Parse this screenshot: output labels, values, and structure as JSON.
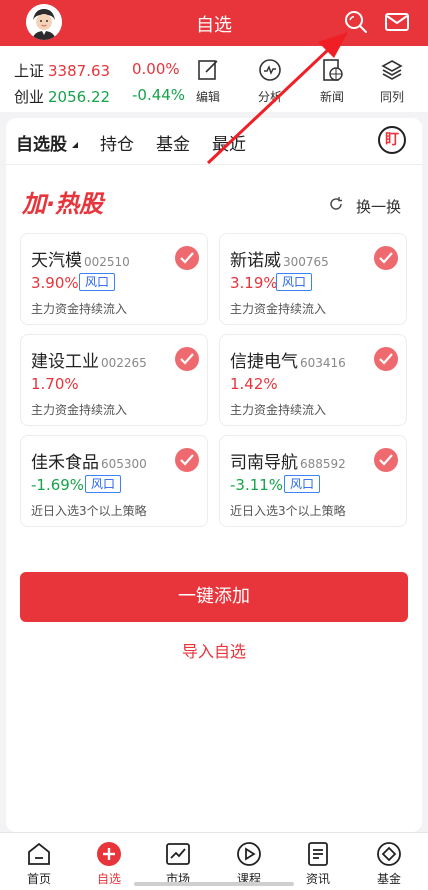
{
  "header": {
    "title": "自选"
  },
  "indices": [
    {
      "name": "上证",
      "value": "3387.63",
      "change": "0.00%",
      "value_color": "red",
      "change_color": "red"
    },
    {
      "name": "创业",
      "value": "2056.22",
      "change": "-0.44%",
      "value_color": "green",
      "change_color": "green"
    }
  ],
  "toolbar": [
    {
      "icon": "edit-icon",
      "label": "编辑"
    },
    {
      "icon": "analysis-icon",
      "label": "分析"
    },
    {
      "icon": "news-icon",
      "label": "新闻"
    },
    {
      "icon": "peer-icon",
      "label": "同列"
    }
  ],
  "tabs": [
    "自选股",
    "持仓",
    "基金",
    "最近"
  ],
  "ding_label": "盯",
  "promo": {
    "title": "加·热股",
    "swap_label": "换一换"
  },
  "stocks": [
    {
      "name": "天汽模",
      "code": "002510",
      "change": "3.90%",
      "color": "red",
      "tag": "风口",
      "desc": "主力资金持续流入"
    },
    {
      "name": "新诺威",
      "code": "300765",
      "change": "3.19%",
      "color": "red",
      "tag": "风口",
      "desc": "主力资金持续流入"
    },
    {
      "name": "建设工业",
      "code": "002265",
      "change": "1.70%",
      "color": "red",
      "tag": "",
      "desc": "主力资金持续流入"
    },
    {
      "name": "信捷电气",
      "code": "603416",
      "change": "1.42%",
      "color": "red",
      "tag": "",
      "desc": "主力资金持续流入"
    },
    {
      "name": "佳禾食品",
      "code": "605300",
      "change": "-1.69%",
      "color": "green",
      "tag": "风口",
      "desc": "近日入选3个以上策略"
    },
    {
      "name": "司南导航",
      "code": "688592",
      "change": "-3.11%",
      "color": "green",
      "tag": "风口",
      "desc": "近日入选3个以上策略"
    }
  ],
  "actions": {
    "add_all": "一键添加",
    "import": "导入自选"
  },
  "nav": [
    "首页",
    "自选",
    "市场",
    "课程",
    "资讯",
    "基金"
  ],
  "colors": {
    "brand_red": "#e8343b",
    "up_red": "#e8343b",
    "down_green": "#16a34a",
    "tag_blue": "#2563eb"
  }
}
